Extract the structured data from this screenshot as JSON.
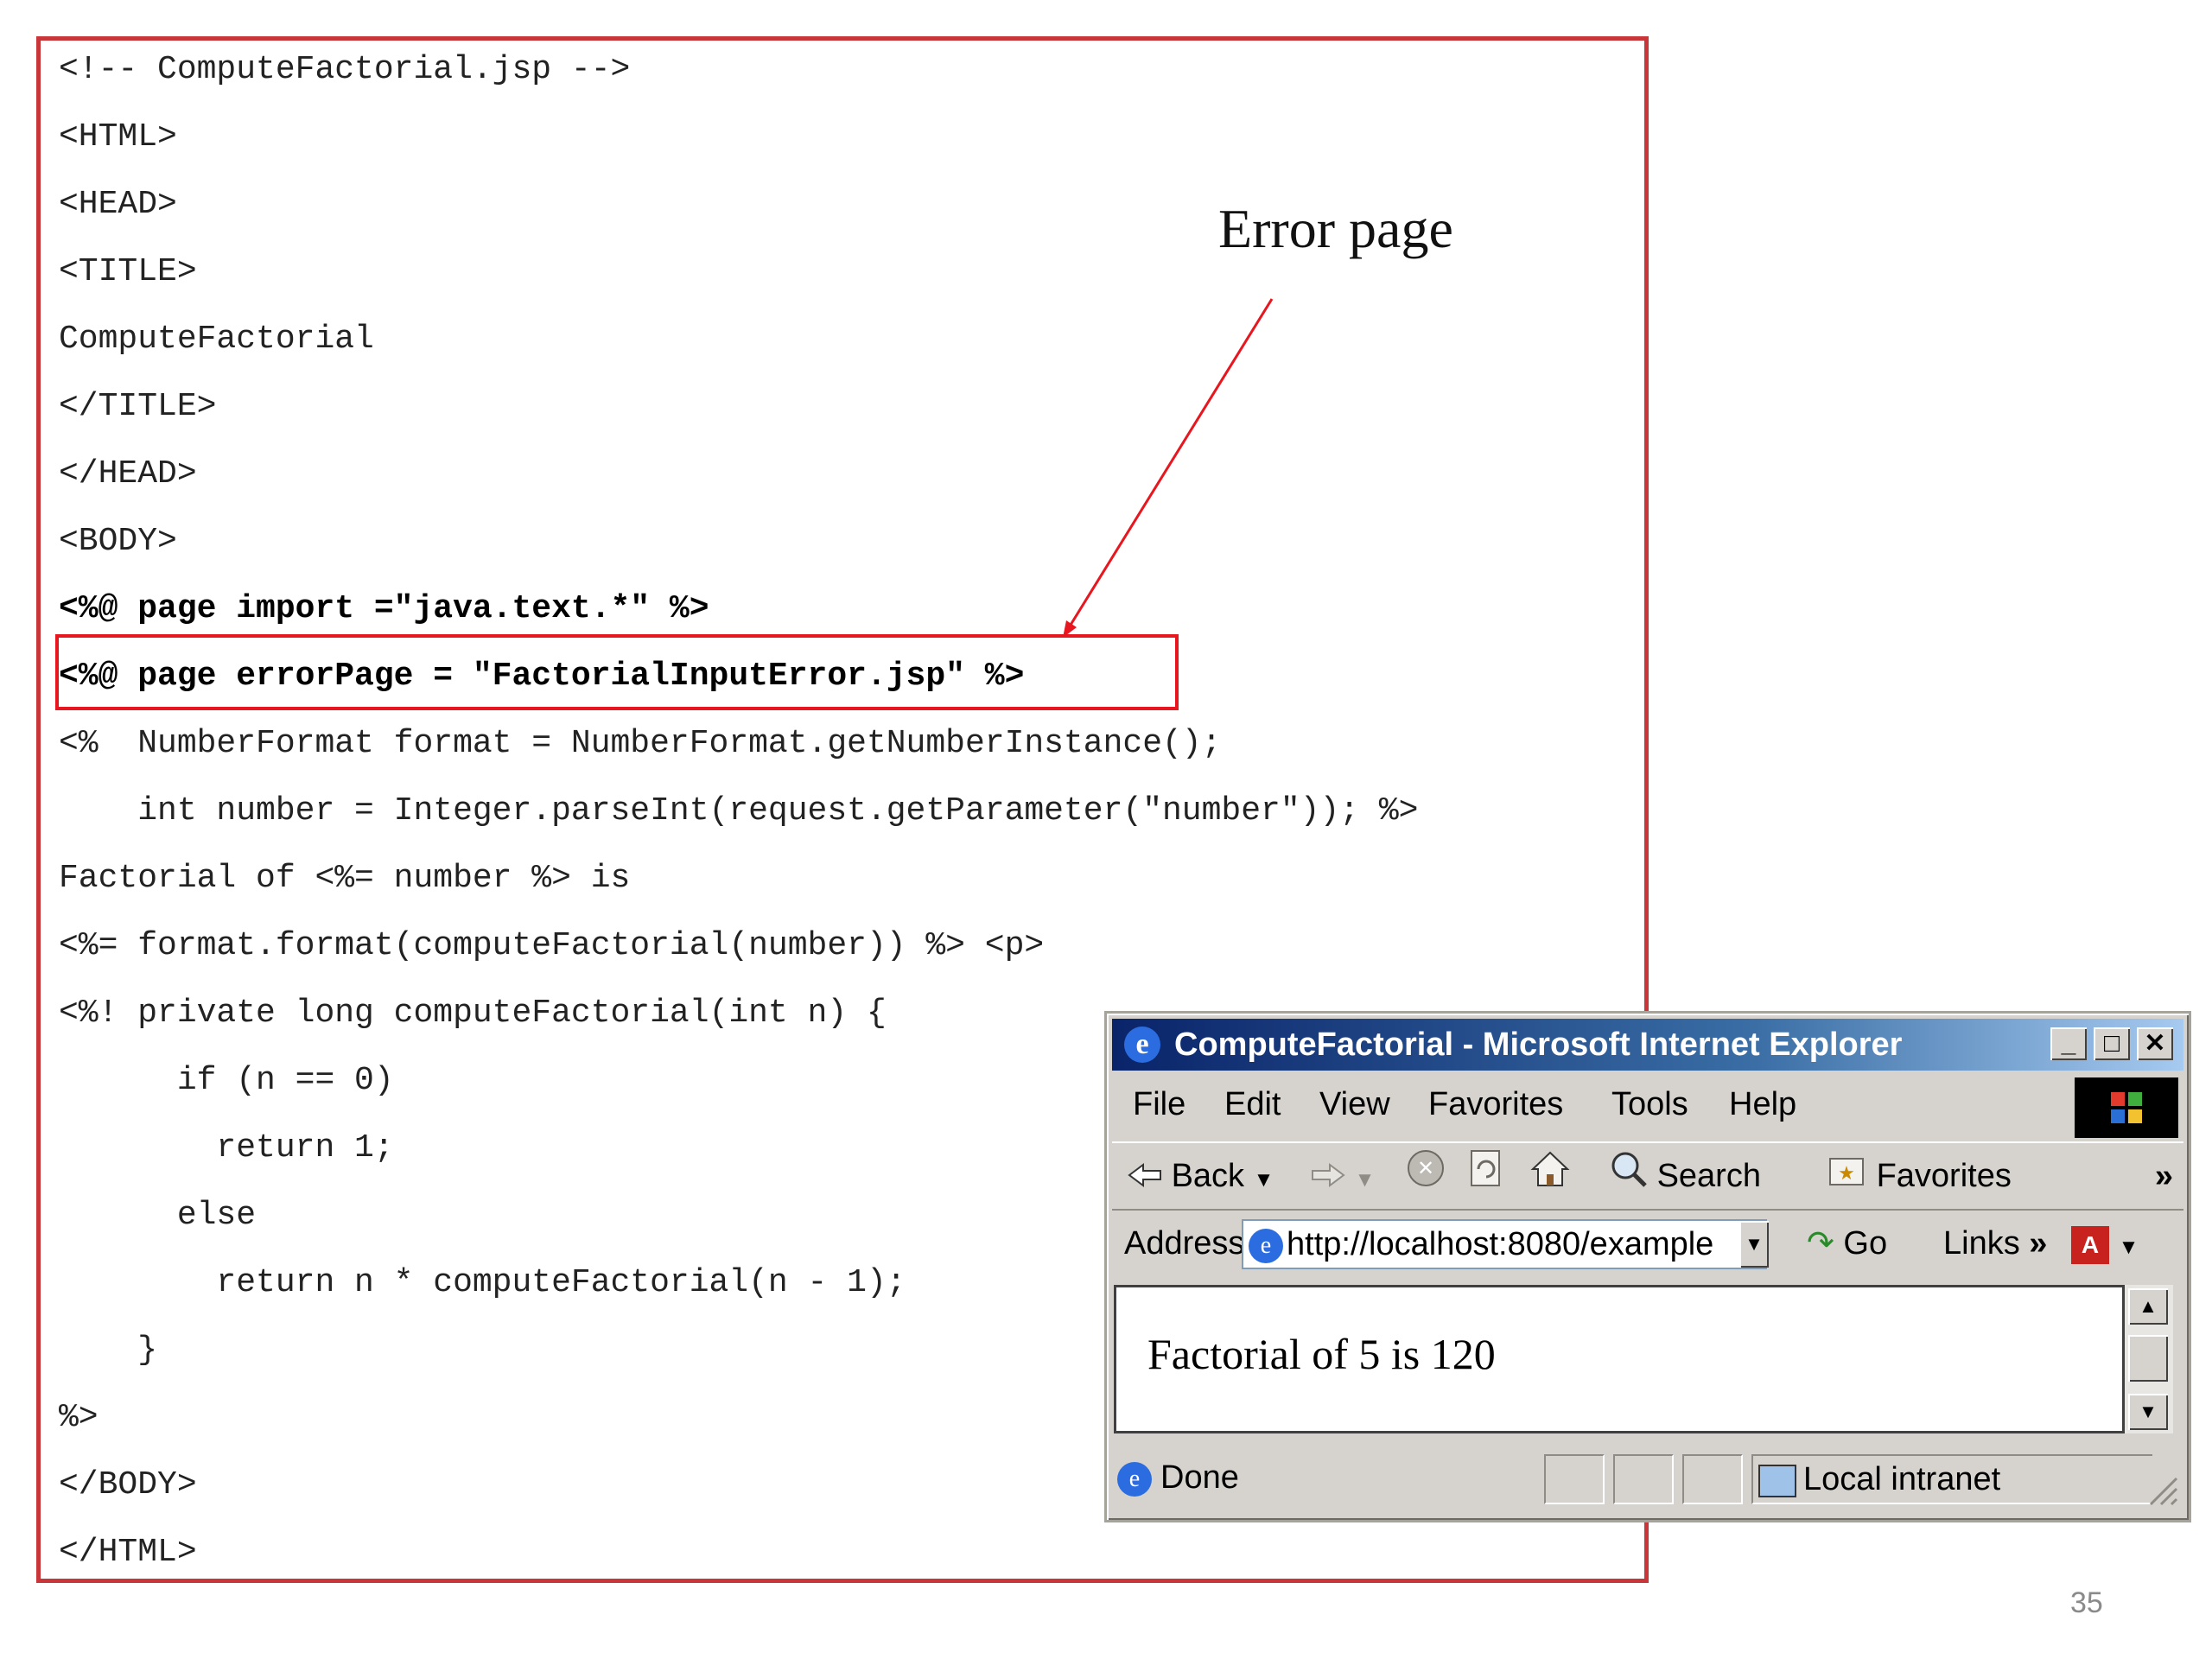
{
  "code_panel": {
    "lines": [
      "<!-- ComputeFactorial.jsp -->",
      "<HTML>",
      "<HEAD>",
      "<TITLE>",
      "ComputeFactorial",
      "</TITLE>",
      "</HEAD>",
      "<BODY>",
      "<%@ page import =\"java.text.*\" %>",
      "<%@ page errorPage = \"FactorialInputError.jsp\" %>",
      "<%  NumberFormat format = NumberFormat.getNumberInstance();",
      "    int number = Integer.parseInt(request.getParameter(\"number\")); %>",
      "Factorial of <%= number %> is",
      "<%= format.format(computeFactorial(number)) %> <p>",
      "<%! private long computeFactorial(int n) {",
      "      if (n == 0)",
      "        return 1;",
      "      else",
      "        return n * computeFactorial(n - 1);",
      "    }",
      "%>",
      "</BODY>",
      "</HTML>"
    ],
    "callout": "Error page"
  },
  "page_number": "35",
  "browser": {
    "title": "ComputeFactorial - Microsoft Internet Explorer",
    "menu": [
      "File",
      "Edit",
      "View",
      "Favorites",
      "Tools",
      "Help"
    ],
    "toolbar": {
      "back": "Back",
      "search": "Search",
      "favorites": "Favorites"
    },
    "address_label": "Address",
    "address_value": "http://localhost:8080/example",
    "go_label": "Go",
    "links_label": "Links",
    "content_text": "Factorial of 5 is 120",
    "status_text": "Done",
    "zone_text": "Local intranet",
    "colors": {
      "title_start": "#0a246a",
      "title_end": "#a6caf0",
      "frame": "#d6d3ce"
    }
  },
  "colors": {
    "code_border": "#c9363a",
    "highlight_border": "#e8161e",
    "arrow": "#e8161e"
  }
}
